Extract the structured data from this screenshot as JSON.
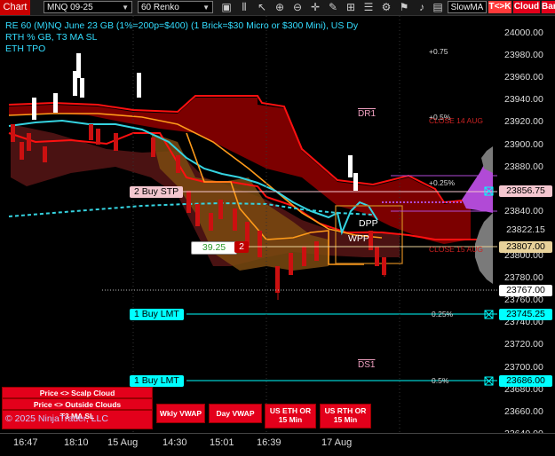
{
  "toolbar": {
    "chart_label": "Chart",
    "instrument": "MNQ 09-25",
    "interval": "60 Renko",
    "indicator": "SlowMA",
    "tlc_label": "T<>K",
    "cloud_label": "Cloud",
    "bar_label": "Bar",
    "icons": [
      "data-box-icon",
      "bars-icon",
      "pointer-icon",
      "zoom-in-icon",
      "zoom-out-icon",
      "crosshair-icon",
      "draw-icon",
      "grid-icon",
      "chart-trader-icon",
      "properties-icon"
    ]
  },
  "header": {
    "line1": "RE 60 (M)NQ June 23 GB (1%=200p=$400) (1 Brick=$30 Micro or $300 Mini), US Dy RTH % GB, T3 MA SL",
    "line2": "ETH TPO"
  },
  "price_axis": {
    "ticks": [
      "24000.00",
      "23980.00",
      "23960.00",
      "23940.00",
      "23920.00",
      "23900.00",
      "23880.00",
      "23860.00",
      "23840.00",
      "23820.00",
      "23800.00",
      "23780.00",
      "23760.00",
      "23740.00",
      "23720.00",
      "23700.00",
      "23680.00",
      "23660.00",
      "23640.00"
    ],
    "labels": [
      {
        "text": "23856.75",
        "bg": "#f4c6cf",
        "fg": "#000"
      },
      {
        "text": "23822.15",
        "bg": "#000000",
        "fg": "#ddd"
      },
      {
        "text": "23807.00",
        "bg": "#e8d29a",
        "fg": "#000"
      },
      {
        "text": "23767.00",
        "bg": "#ffffff",
        "fg": "#000"
      },
      {
        "text": "23745.25",
        "bg": "#00ffff",
        "fg": "#000"
      },
      {
        "text": "23686.00",
        "bg": "#00ffff",
        "fg": "#000"
      }
    ]
  },
  "time_axis": [
    "16:47",
    "18:10",
    "15 Aug",
    "14:30",
    "15:01",
    "16:39",
    "17 Aug"
  ],
  "levels": {
    "p075": "+0.75",
    "p05": "+0.5%",
    "p025": "+0.25%",
    "n025": "0.25%",
    "n05": "0.5%",
    "close14": "CLOSE 14 AUG",
    "close15": "CLOSE 15 AUG",
    "close_top": "CLOSE 15 AUG"
  },
  "markers": {
    "dr1": "DR1",
    "ds1": "DS1",
    "dpp": "DPP",
    "wpp": "WPP"
  },
  "orders": {
    "buy_stp": "2 Buy STP",
    "buy_lmt_1": "1 Buy LMT",
    "buy_lmt_2": "1 Buy LMT",
    "pnl": "39.25",
    "pnl_qty": "2"
  },
  "buttons": {
    "scalp_cloud": "Price <> Scalp Cloud",
    "outside_clouds": "Price <> Outside Clouds",
    "t3_ma_sl": "T3 MA SL",
    "wkly_vwap": "Wkly VWAP",
    "day_vwap": "Day VWAP",
    "us_eth_or": "US ETH OR 15 Min",
    "us_rth_or": "US RTH OR 15 Min"
  },
  "copyright": "© 2025 NinjaTrader, LLC",
  "colors": {
    "cloud_red": "#c00000",
    "cloud_dark": "#5a1010",
    "cyan_line": "#35d3e0",
    "orange_line": "#ff9b1a",
    "button_red": "#e3001b",
    "order_cyan": "#00ffff"
  }
}
